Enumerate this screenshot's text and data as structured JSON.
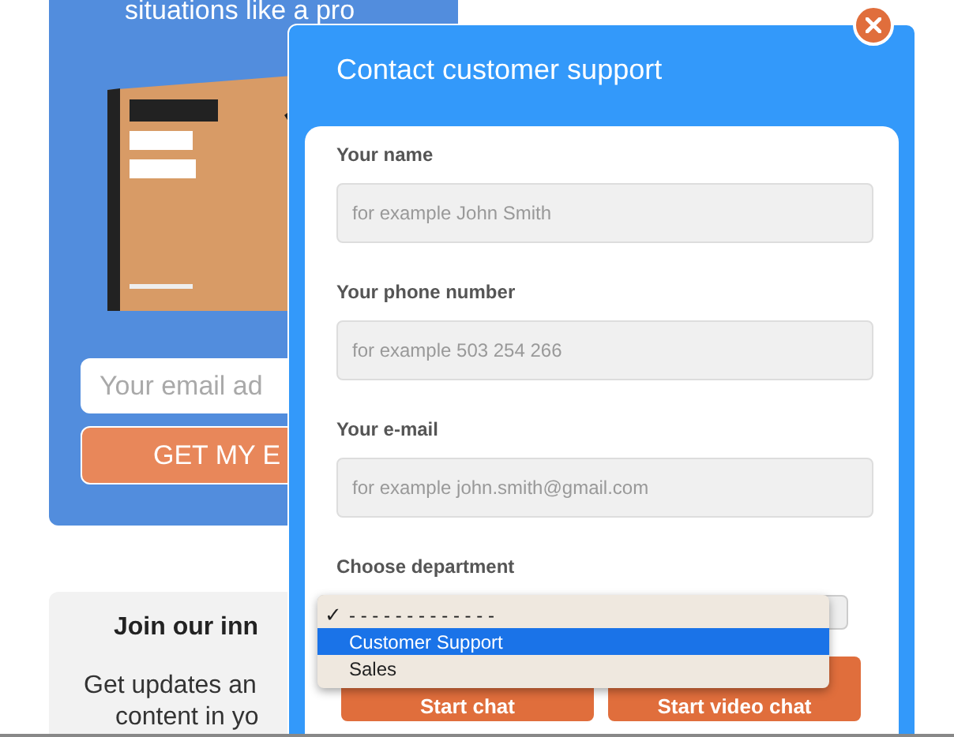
{
  "promo": {
    "heading": "situations like a pro",
    "email_placeholder": "Your email ad",
    "button": "GET MY E"
  },
  "newsletter": {
    "title": "Join our inn",
    "text_lines": [
      "Get updates an",
      "content in yo"
    ]
  },
  "dialog": {
    "title": "Contact customer support",
    "fields": [
      {
        "label": "Your name",
        "placeholder": "for example John Smith"
      },
      {
        "label": "Your phone number",
        "placeholder": "for example 503 254 266"
      },
      {
        "label": "Your e-mail",
        "placeholder": "for example john.smith@gmail.com"
      }
    ],
    "department": {
      "label": "Choose department",
      "check_mark": "✓",
      "options": [
        {
          "label": "- - - - - - - - - - - - -",
          "checked": true,
          "selected": false
        },
        {
          "label": "Customer Support",
          "checked": false,
          "selected": true
        },
        {
          "label": "Sales",
          "checked": false,
          "selected": false
        }
      ]
    },
    "buttons": [
      "Start chat",
      "Start video chat"
    ]
  }
}
